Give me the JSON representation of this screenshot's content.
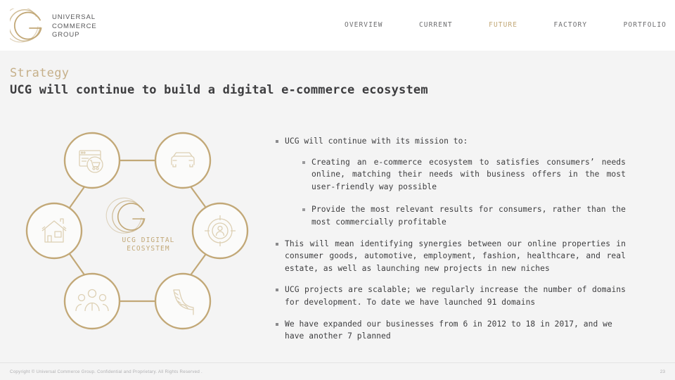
{
  "brand": {
    "name_line1": "UNIVERSAL",
    "name_line2": "COMMERCE",
    "name_line3": "GROUP",
    "gold": "#c2a877",
    "dark": "#58585a"
  },
  "nav": {
    "items": [
      {
        "label": "OVERVIEW",
        "active": false
      },
      {
        "label": "CURRENT",
        "active": false
      },
      {
        "label": "FUTURE",
        "active": true
      },
      {
        "label": "FACTORY",
        "active": false
      },
      {
        "label": "PORTFOLIO",
        "active": false
      }
    ]
  },
  "title": {
    "eyebrow": "Strategy",
    "headline": "UCG will continue to build a digital e-commerce ecosystem"
  },
  "diagram": {
    "hub_label_line1": "UCG DIGITAL",
    "hub_label_line2": "ECOSYSTEM",
    "accent": "#c2a877",
    "nodes": [
      {
        "id": "consumer-goods",
        "icon": "shopping-cart-browser-icon",
        "position": "top-left"
      },
      {
        "id": "automotive",
        "icon": "car-icon",
        "position": "top-right"
      },
      {
        "id": "healthcare",
        "icon": "target-person-icon",
        "position": "right"
      },
      {
        "id": "fashion",
        "icon": "high-heel-shoe-icon",
        "position": "bottom-right"
      },
      {
        "id": "employment",
        "icon": "people-group-icon",
        "position": "bottom-left"
      },
      {
        "id": "real-estate",
        "icon": "house-icon",
        "position": "left"
      }
    ]
  },
  "content": {
    "bullets": [
      {
        "text": "UCG will continue with its mission to:",
        "justify": false,
        "sub": [
          {
            "text": "Creating an e-commerce ecosystem to satisfies consumers’ needs online, matching their needs with business offers in the most user-friendly way possible",
            "justify": true
          },
          {
            "text": "Provide the most relevant results for consumers, rather than the most commercially profitable",
            "justify": true
          }
        ]
      },
      {
        "text": "This will mean identifying synergies between our online properties in consumer goods, automotive, employment, fashion, healthcare, and real estate, as well as launching new projects in new niches",
        "justify": true,
        "sub": []
      },
      {
        "text": "UCG projects are scalable; we regularly increase the number of domains for development.  To date we have launched 91 domains",
        "justify": true,
        "sub": []
      },
      {
        "text": "We have expanded our businesses from 6 in 2012 to 18 in 2017, and we have another 7 planned",
        "justify": true,
        "sub": []
      }
    ]
  },
  "footer": {
    "copyright": "Copyright © Universal Commerce Group. Confidential and Proprietary. All Rights Reserved .",
    "page_number": "23"
  }
}
